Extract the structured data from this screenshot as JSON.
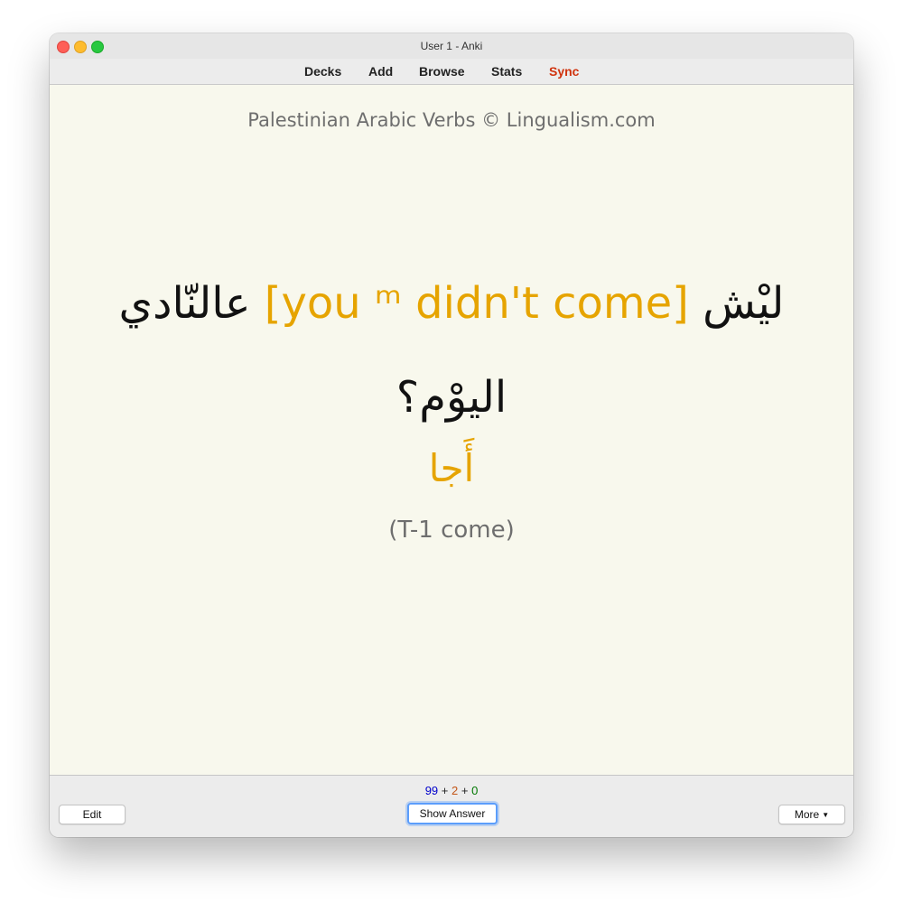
{
  "window": {
    "title": "User 1 - Anki"
  },
  "toolbar": {
    "items": [
      {
        "label": "Decks"
      },
      {
        "label": "Add"
      },
      {
        "label": "Browse"
      },
      {
        "label": "Stats"
      },
      {
        "label": "Sync"
      }
    ]
  },
  "card": {
    "credit": "Palestinian Arabic Verbs © Lingualism.com",
    "sentence_end": "ليْش",
    "sentence_highlight": "[you ᵐ didn't come]",
    "sentence_mid": "عالنّادي",
    "sentence_line2": "اليوْم؟",
    "answer_word": "أَجا",
    "verb_note": "(T-1 come)"
  },
  "bottom": {
    "count_new": "99",
    "plus1": "+",
    "count_learn": "2",
    "plus2": "+",
    "count_review": "0",
    "edit_label": "Edit",
    "show_answer_label": "Show Answer",
    "more_label": "More"
  },
  "colors": {
    "highlight": "#e6a400",
    "sync": "#d0330e",
    "new": "#0000cc",
    "learn": "#c35617",
    "review": "#007700"
  }
}
